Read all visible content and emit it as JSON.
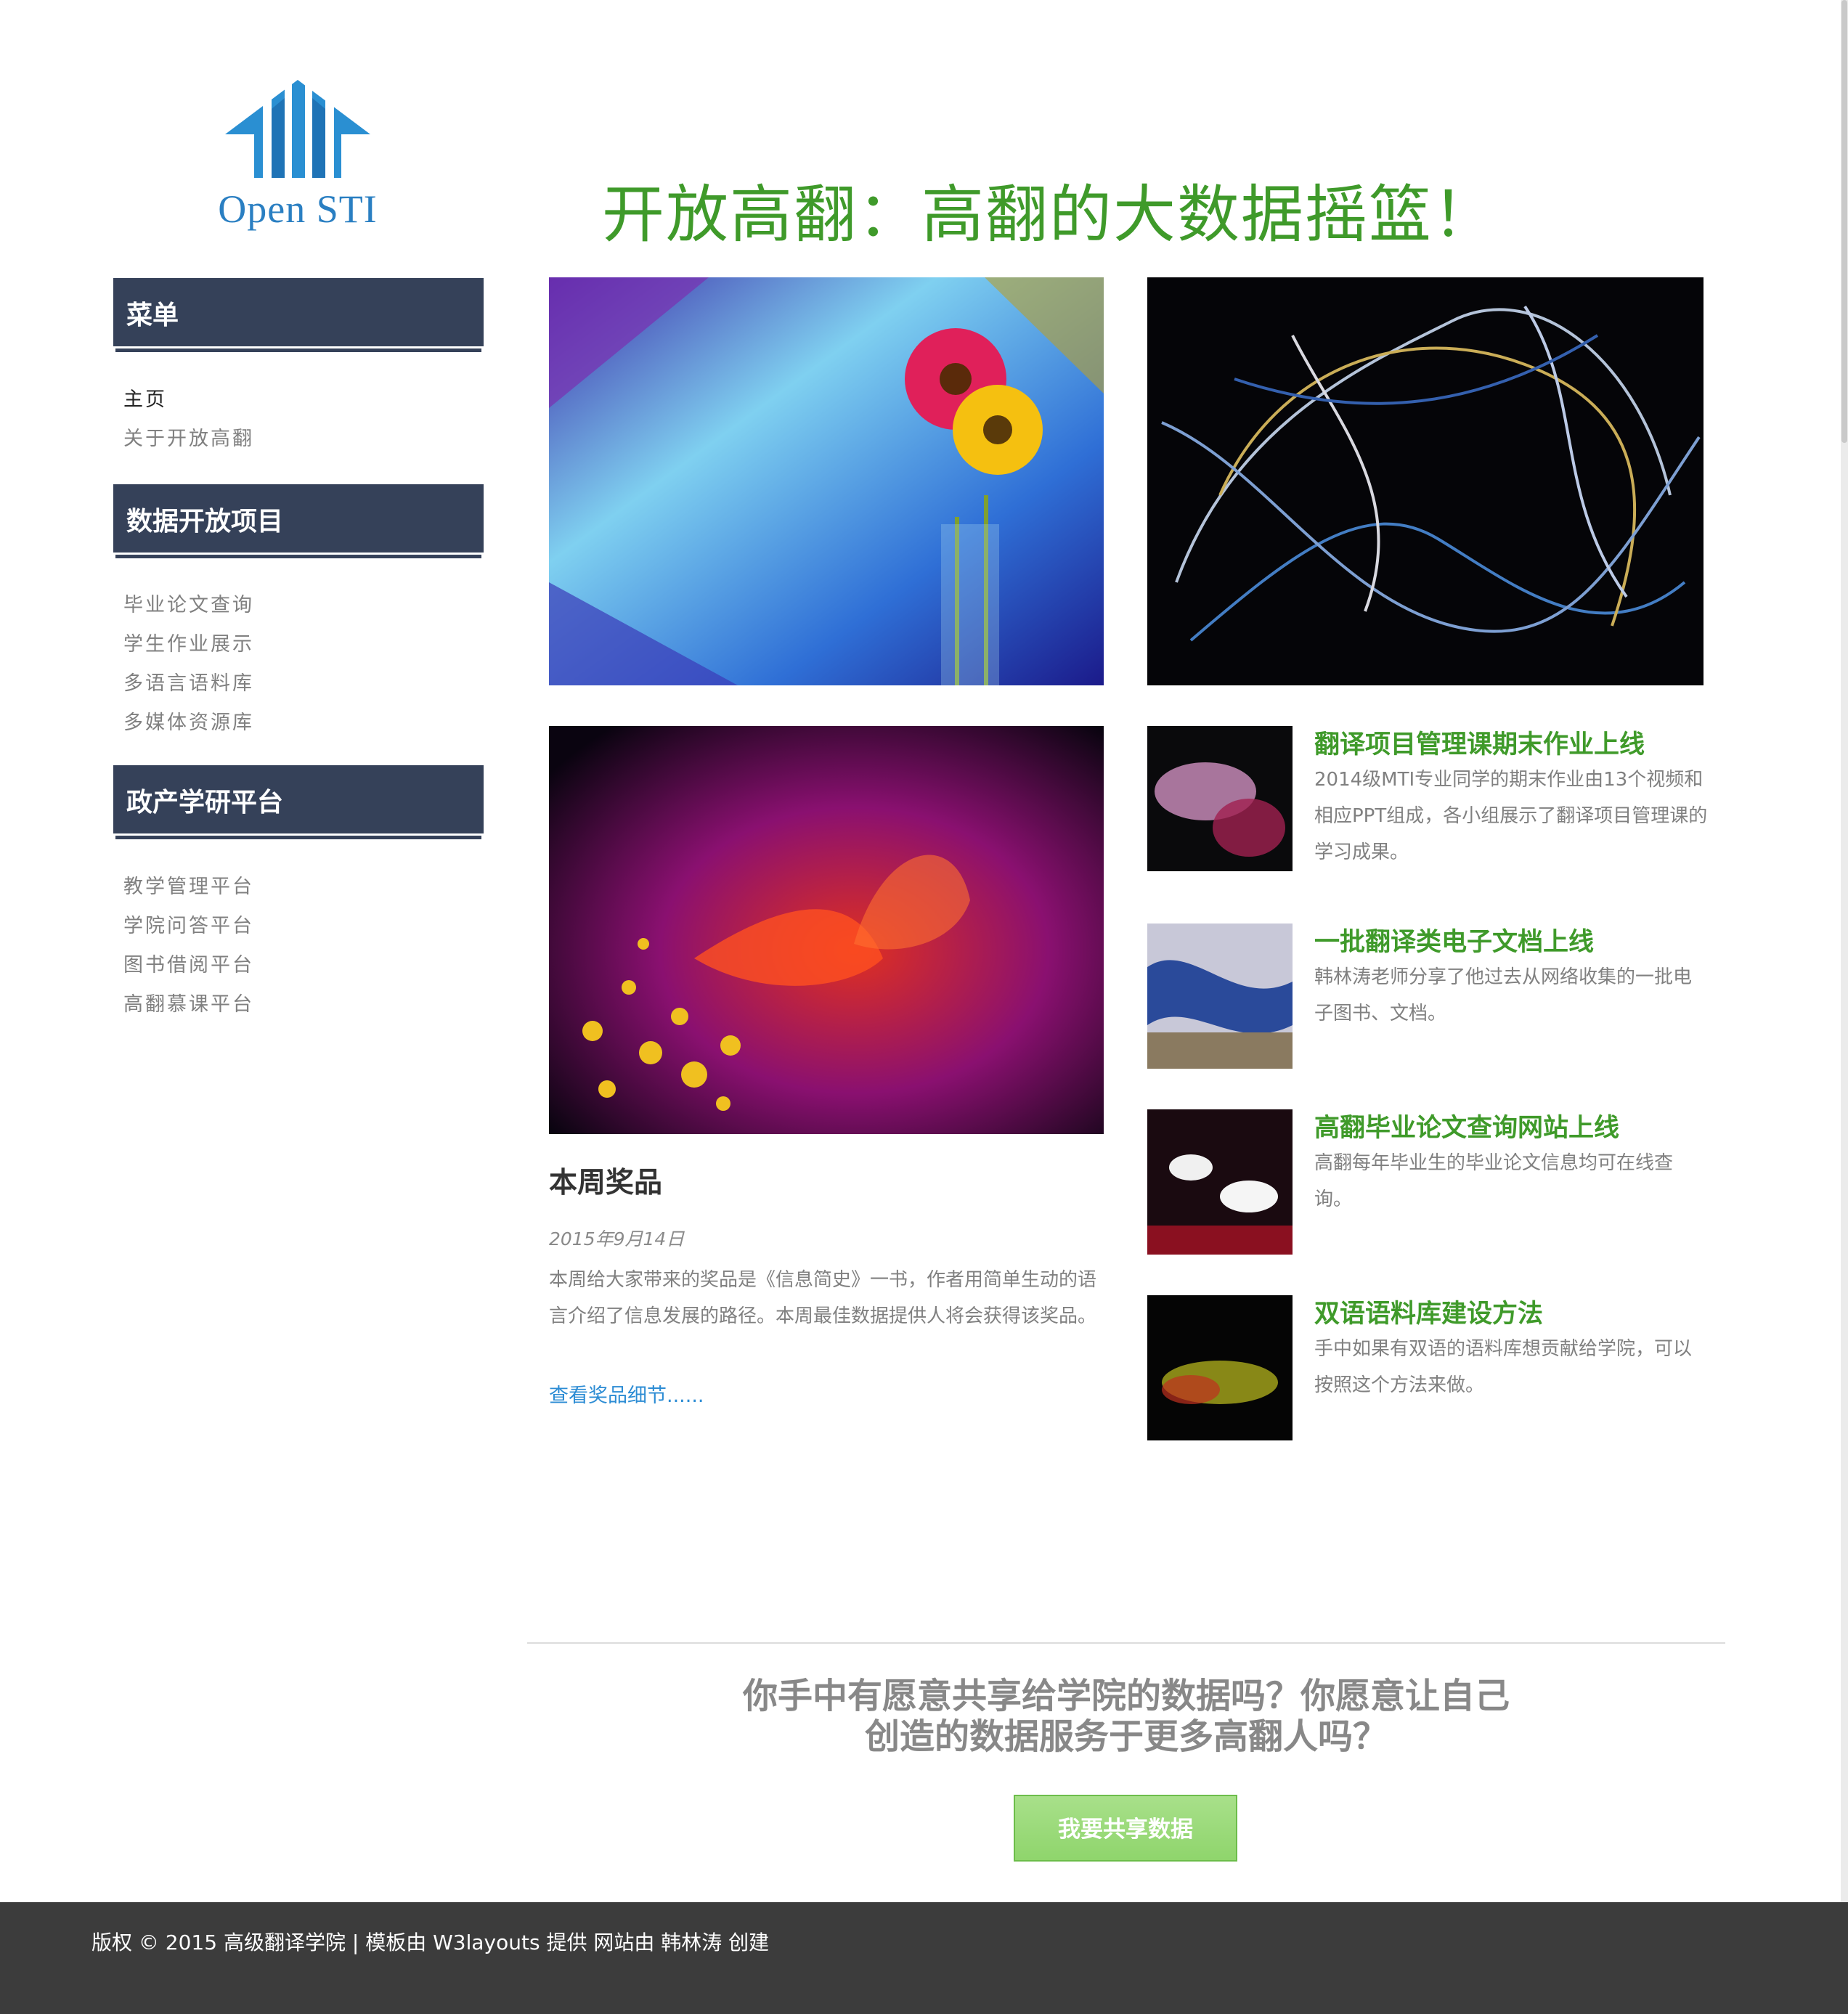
{
  "logo": {
    "text": "Open STI",
    "brand_color": "#2a7fc2"
  },
  "headline": "开放高翻：高翻的大数据摇篮！",
  "sidebar": {
    "sections": [
      {
        "title": "菜单",
        "items": [
          "主页",
          "关于开放高翻"
        ]
      },
      {
        "title": "数据开放项目",
        "items": [
          "毕业论文查询",
          "学生作业展示",
          "多语言语料库",
          "多媒体资源库"
        ]
      },
      {
        "title": "政产学研平台",
        "items": [
          "教学管理平台",
          "学院问答平台",
          "图书借阅平台",
          "高翻慕课平台"
        ]
      }
    ],
    "active_item": "主页",
    "header_color": "#354159"
  },
  "feature": {
    "title": "本周奖品",
    "date": "2015年9月14日",
    "body": "本周给大家带来的奖品是《信息简史》一书，作者用简单生动的语言介绍了信息发展的路径。本周最佳数据提供人将会获得该奖品。",
    "more": "查看奖品细节......"
  },
  "news": [
    {
      "title": "翻译项目管理课期末作业上线",
      "desc": "2014级MTI专业同学的期末作业由13个视频和相应PPT组成，各小组展示了翻译项目管理课的学习成果。"
    },
    {
      "title": "一批翻译类电子文档上线",
      "desc": "韩林涛老师分享了他过去从网络收集的一批电子图书、文档。"
    },
    {
      "title": "高翻毕业论文查询网站上线",
      "desc": "高翻每年毕业生的毕业论文信息均可在线查询。"
    },
    {
      "title": "双语语料库建设方法",
      "desc": "手中如果有双语的语料库想贡献给学院，可以按照这个方法来做。"
    }
  ],
  "cta": {
    "line1": "你手中有愿意共享给学院的数据吗？你愿意让自己",
    "line2": "创造的数据服务于更多高翻人吗？",
    "button": "我要共享数据"
  },
  "footer": "版权 © 2015 高级翻译学院 | 模板由 W3layouts 提供 网站由 韩林涛 创建",
  "colors": {
    "accent_green": "#3f9a2a",
    "link_blue": "#2c8cd4",
    "footer_bg": "#3c3c3c"
  }
}
